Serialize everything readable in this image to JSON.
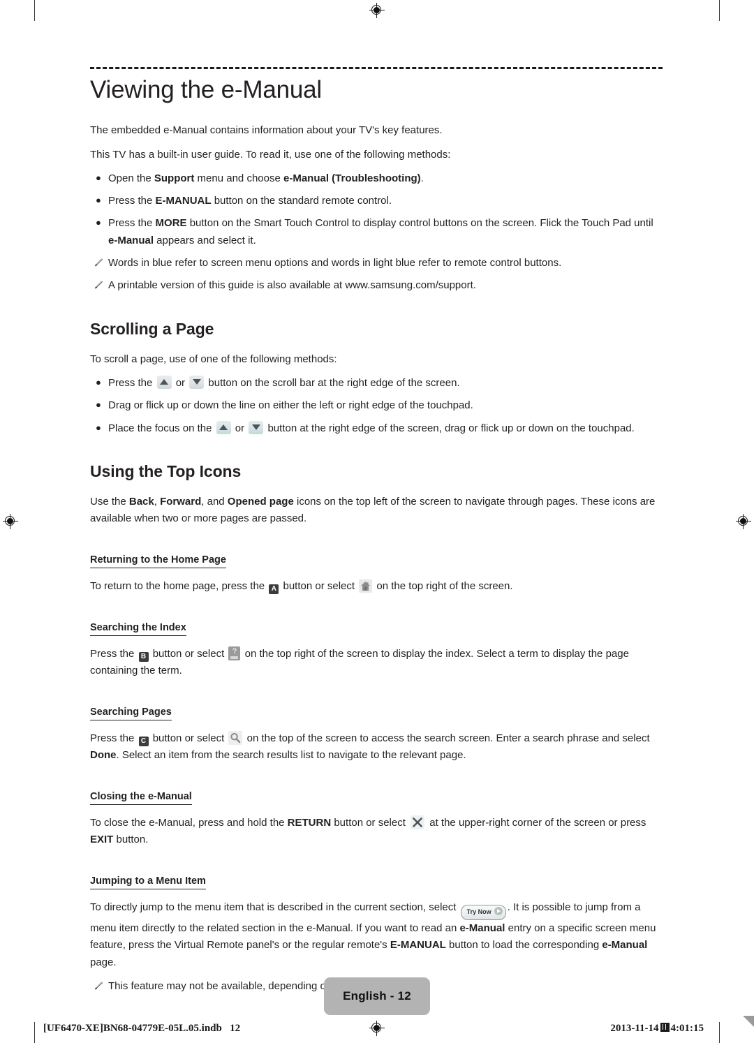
{
  "document": {
    "title": "Viewing the e-Manual",
    "intro": [
      "The embedded e-Manual contains information about your TV's key features.",
      "This TV has a built-in user guide. To read it, use one of the following methods:"
    ],
    "intro_bullets": [
      {
        "marker": "•",
        "parts": [
          {
            "text": "Open the ",
            "bold": false
          },
          {
            "text": "Support",
            "bold": true
          },
          {
            "text": " menu and choose ",
            "bold": false
          },
          {
            "text": "e-Manual (Troubleshooting)",
            "bold": true
          },
          {
            "text": ".",
            "bold": false
          }
        ]
      },
      {
        "marker": "•",
        "parts": [
          {
            "text": "Press the ",
            "bold": false
          },
          {
            "text": "E-MANUAL",
            "bold": true
          },
          {
            "text": " button on the standard remote control.",
            "bold": false
          }
        ]
      },
      {
        "marker": "•",
        "parts": [
          {
            "text": "Press the ",
            "bold": false
          },
          {
            "text": "MORE",
            "bold": true
          },
          {
            "text": " button on the Smart Touch Control to display control buttons on the screen. Flick the Touch Pad until ",
            "bold": false
          },
          {
            "text": "e-Manual",
            "bold": true
          },
          {
            "text": " appears and select it.",
            "bold": false
          }
        ]
      }
    ],
    "intro_notes": [
      "Words in blue refer to screen menu options and words in light blue refer to remote control buttons.",
      "A printable version of this guide is also available at www.samsung.com/support."
    ]
  },
  "scrolling_section": {
    "heading": "Scrolling a Page",
    "lead": "To scroll a page, use of one of the following methods:",
    "bullets": {
      "b1_pre": "Press the ",
      "b1_mid": " or ",
      "b1_post": " button on the scroll bar at the right edge of the screen.",
      "b2": "Drag or flick up or down the line on either the left or right edge of the touchpad.",
      "b3_pre": "Place the focus on the ",
      "b3_mid": " or ",
      "b3_post": " button at the right edge of the screen, drag or flick up or down on the touchpad."
    },
    "icons": {
      "up": "scroll-up-arrow-icon",
      "down": "scroll-down-arrow-icon"
    }
  },
  "top_icons_section": {
    "heading": "Using the Top Icons",
    "lead_parts": [
      {
        "text": "Use the ",
        "bold": false
      },
      {
        "text": "Back",
        "bold": true
      },
      {
        "text": ", ",
        "bold": false
      },
      {
        "text": "Forward",
        "bold": true
      },
      {
        "text": ", and ",
        "bold": false
      },
      {
        "text": "Opened page",
        "bold": true
      },
      {
        "text": " icons on the top left of the screen to navigate through pages. These icons are available when two or more pages are passed.",
        "bold": false
      }
    ],
    "subsections": [
      {
        "title": "Returning to the Home Page",
        "text_pre": "To return to the home page, press the ",
        "key": "A",
        "text_mid": " button or select ",
        "icon": "home-icon",
        "text_post": " on the top right of the screen."
      },
      {
        "title": "Searching the Index",
        "text_pre": "Press the ",
        "key": "B",
        "text_mid": " button or select ",
        "icon": "help-question-icon",
        "text_post": " on the top right of the screen to display the index. Select a term to display the page containing the term."
      },
      {
        "title": "Searching Pages",
        "text_pre": "Press the ",
        "key": "C",
        "text_mid": " button or select ",
        "icon": "search-magnifier-icon",
        "text_post_a": " on the top of the screen to access the search screen. Enter a search phrase and select ",
        "text_post_bold": "Done",
        "text_post_b": ". Select an item from the search results list to navigate to the relevant page."
      },
      {
        "title": "Closing the e-Manual",
        "close_pre": "To close the e-Manual, press and hold the ",
        "close_bold1": "RETURN",
        "close_mid": " button or select ",
        "icon": "close-x-icon",
        "close_post": " at the upper-right corner of the screen or press ",
        "close_bold2": "EXIT",
        "close_end": " button."
      },
      {
        "title": "Jumping to a Menu Item",
        "jump_pre": "To directly jump to the menu item that is described in the current section, select ",
        "try_now_label": "Try Now",
        "jump_mid_a": ". It is possible to jump from a menu item directly to the related section in the e-Manual. If you want to read an ",
        "jump_bold1": "e-Manual",
        "jump_mid_b": " entry on a specific screen menu feature, press the Virtual Remote panel's or the regular remote's ",
        "jump_bold2": "E-MANUAL",
        "jump_mid_c": " button to load the corresponding ",
        "jump_bold3": "e-Manual",
        "jump_end": " page.",
        "note": "This feature may not be available, depending on the menu."
      }
    ]
  },
  "footer": {
    "page_label": "English - 12",
    "file_name": "[UF6470-XE]BN68-04779E-05L.05.indb   12",
    "date": "2013-11-14",
    "time": "4:01:15"
  },
  "colors": {
    "text": "#231f20",
    "badge_bg": "#b3b3b3",
    "icon_gray": "#e6e9ea",
    "key_dark": "#3c3c3c"
  }
}
